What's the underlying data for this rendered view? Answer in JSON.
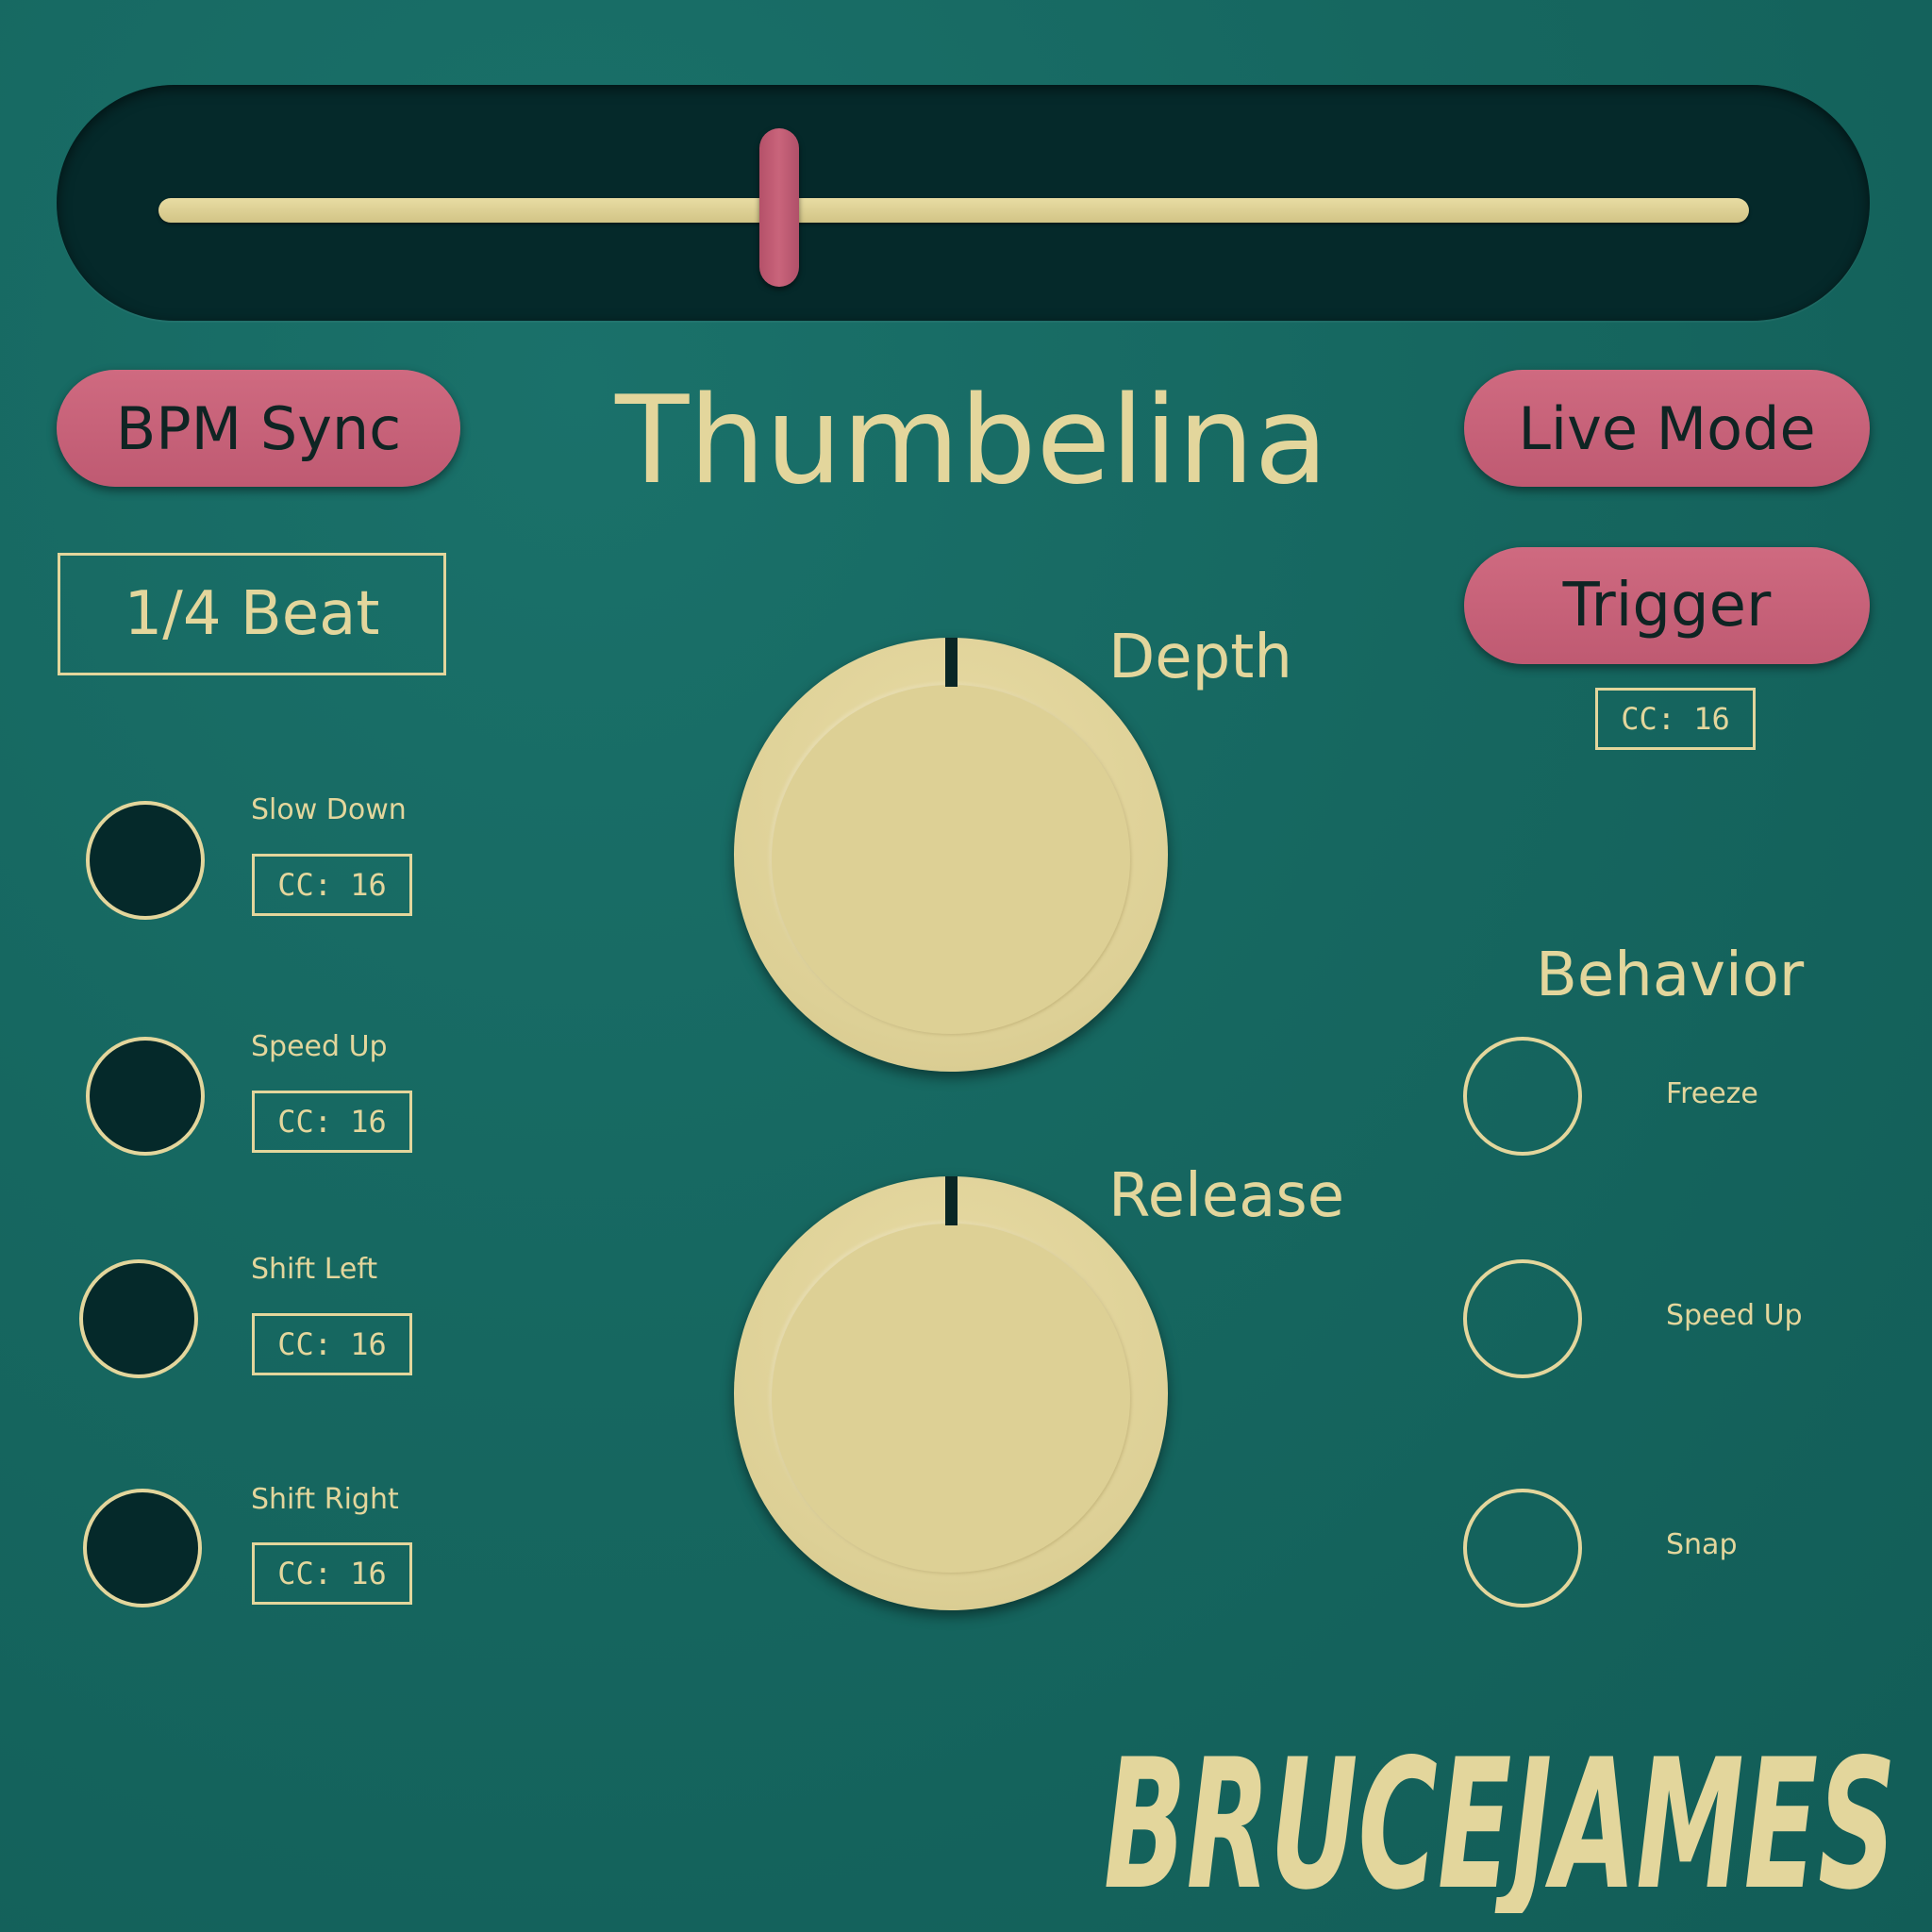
{
  "window": {
    "title": "Thumbelina"
  },
  "slider": {
    "value": 0.39
  },
  "buttons": {
    "bpm_sync": "BPM Sync",
    "live_mode": "Live Mode",
    "trigger": "Trigger",
    "trigger_cc": "CC: 16"
  },
  "beat_division": "1/4 Beat",
  "actions": [
    {
      "label": "Slow Down",
      "cc": "CC: 16"
    },
    {
      "label": "Speed Up",
      "cc": "CC: 16"
    },
    {
      "label": "Shift Left",
      "cc": "CC: 16"
    },
    {
      "label": "Shift Right",
      "cc": "CC: 16"
    }
  ],
  "knobs": {
    "depth": {
      "label": "Depth"
    },
    "release": {
      "label": "Release"
    }
  },
  "behavior": {
    "title": "Behavior",
    "options": [
      {
        "label": "Freeze"
      },
      {
        "label": "Speed Up"
      },
      {
        "label": "Snap"
      }
    ]
  },
  "brand": {
    "logo_text": "BRUCEJAMES"
  },
  "colors": {
    "background": "#166760",
    "panel_dark": "#05292a",
    "cream": "#e3d69c",
    "pink": "#c9647b"
  }
}
